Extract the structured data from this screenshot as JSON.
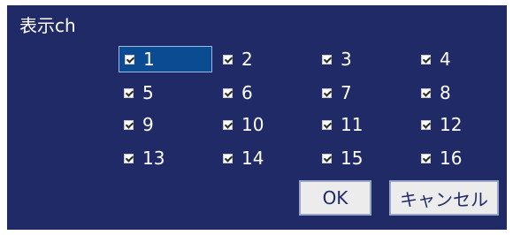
{
  "dialog": {
    "title": "表示ch"
  },
  "channels": [
    {
      "label": "1",
      "checked": true,
      "selected": true
    },
    {
      "label": "2",
      "checked": true
    },
    {
      "label": "3",
      "checked": true
    },
    {
      "label": "4",
      "checked": true
    },
    {
      "label": "5",
      "checked": true
    },
    {
      "label": "6",
      "checked": true
    },
    {
      "label": "7",
      "checked": true
    },
    {
      "label": "8",
      "checked": true
    },
    {
      "label": "9",
      "checked": true
    },
    {
      "label": "10",
      "checked": true
    },
    {
      "label": "11",
      "checked": true
    },
    {
      "label": "12",
      "checked": true
    },
    {
      "label": "13",
      "checked": true
    },
    {
      "label": "14",
      "checked": true
    },
    {
      "label": "15",
      "checked": true
    },
    {
      "label": "16",
      "checked": true
    }
  ],
  "buttons": {
    "ok": "OK",
    "cancel": "キャンセル"
  },
  "colors": {
    "dialog_bg": "#1f2a66",
    "selected_bg": "#0b4b91",
    "text": "#ffffff",
    "button_bg": "#ececec"
  }
}
